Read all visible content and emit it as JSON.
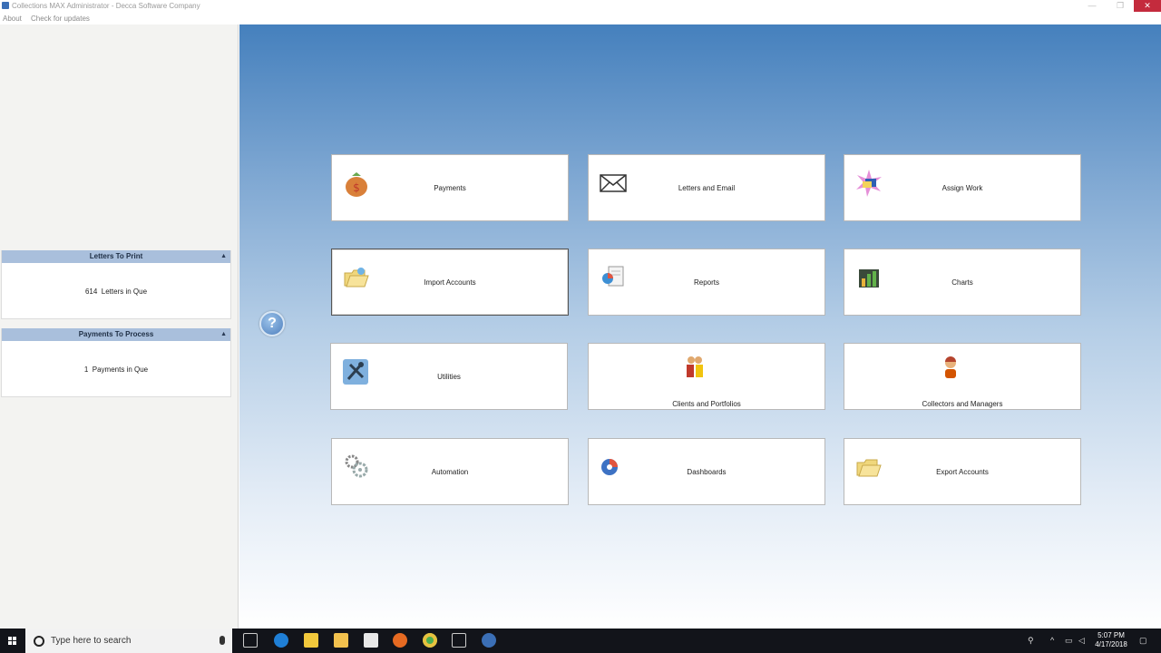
{
  "window": {
    "title": "Collections MAX Administrator - Decca Software Company",
    "controls": {
      "minimize": "—",
      "maximize": "❐",
      "close": "✕"
    }
  },
  "menu": {
    "items": [
      "About",
      "Check for updates"
    ]
  },
  "sidebar": {
    "letters_panel": {
      "title": "Letters To Print",
      "count": "614",
      "text": "Letters in Que"
    },
    "payments_panel": {
      "title": "Payments To Process",
      "count": "1",
      "text": "Payments in Que"
    }
  },
  "help": {
    "glyph": "?"
  },
  "tiles": [
    {
      "label": "Payments",
      "icon": "money-bag-icon"
    },
    {
      "label": "Letters and Email",
      "icon": "envelope-icon"
    },
    {
      "label": "Assign Work",
      "icon": "assign-work-icon"
    },
    {
      "label": "Import Accounts",
      "icon": "folder-import-icon"
    },
    {
      "label": "Reports",
      "icon": "report-icon"
    },
    {
      "label": "Charts",
      "icon": "bar-chart-icon"
    },
    {
      "label": "Utilities",
      "icon": "tools-icon"
    },
    {
      "label": "Clients and Portfolios",
      "icon": "clients-icon"
    },
    {
      "label": "Collectors and Managers",
      "icon": "collector-icon"
    },
    {
      "label": "Automation",
      "icon": "gears-icon"
    },
    {
      "label": "Dashboards",
      "icon": "dashboard-gauge-icon"
    },
    {
      "label": "Export Accounts",
      "icon": "folder-export-icon"
    }
  ],
  "taskbar": {
    "search_placeholder": "Type here to search",
    "clock": {
      "time": "5:07 PM",
      "date": "4/17/2018"
    }
  }
}
